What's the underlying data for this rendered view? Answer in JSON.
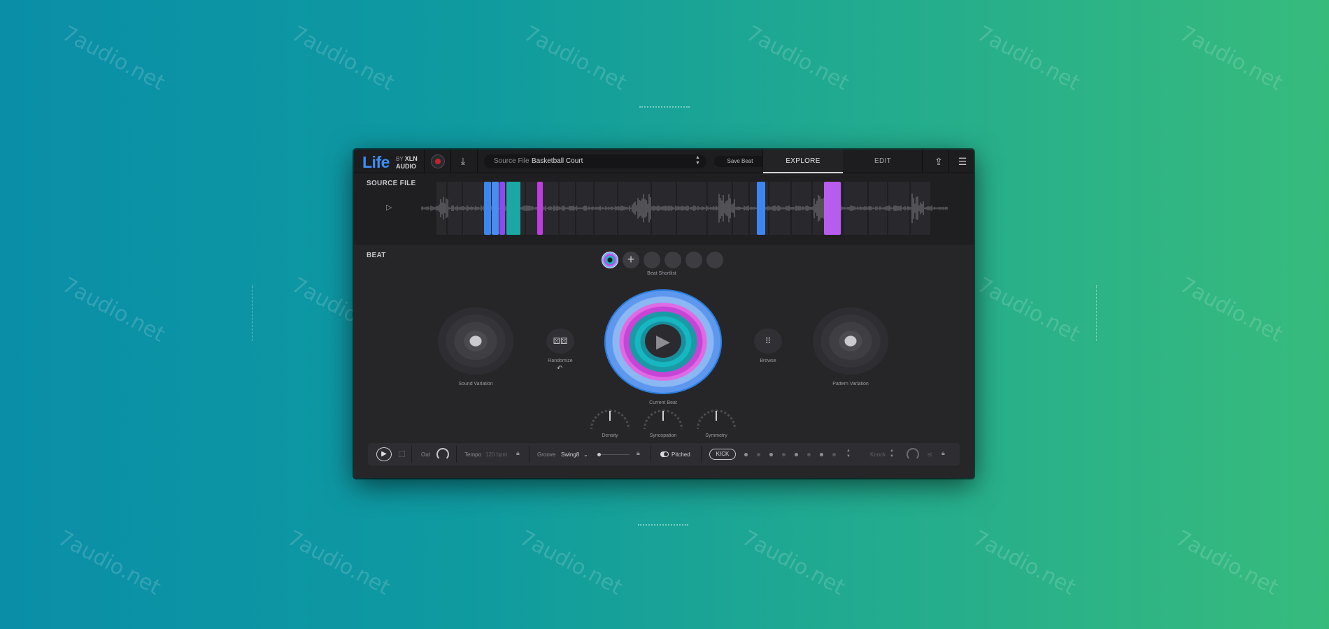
{
  "watermark": "7audio.net",
  "header": {
    "logo": "Life",
    "logo_by": "BY",
    "logo_brand": "XLN",
    "logo_brand2": "AUDIO",
    "source_label": "Source File",
    "source_value": "Basketball Court",
    "save_label": "Save Beat",
    "tabs": [
      {
        "label": "EXPLORE",
        "active": true
      },
      {
        "label": "EDIT",
        "active": false
      }
    ]
  },
  "source_section": {
    "title": "SOURCE FILE",
    "segment_colors": [
      "#3d86ef",
      "#8a4cf0",
      "#1ba7a4",
      "#c13ce0",
      "#b85cf0"
    ]
  },
  "beat_section": {
    "title": "BEAT",
    "shortlist_label": "Beat Shortlist",
    "sound_variation_label": "Sound Variation",
    "randomize_label": "Randomize",
    "browse_label": "Browse",
    "current_beat_label": "Current Beat",
    "pattern_variation_label": "Pattern Variation",
    "knobs": [
      {
        "label": "Density"
      },
      {
        "label": "Syncopation"
      },
      {
        "label": "Symmetry"
      }
    ]
  },
  "transport": {
    "out_label": "Out",
    "tempo_label": "Tempo",
    "tempo_value": "120 bpm",
    "groove_label": "Groove",
    "groove_value": "Swing8",
    "pitched_label": "Pitched",
    "kick_label": "KICK",
    "knock_label": "Knock",
    "extra_label": "st"
  },
  "colors": {
    "accent_blue": "#3f8ef4",
    "magenta": "#d83ce2",
    "teal": "#17b3c1",
    "record_red": "#c0242f"
  }
}
